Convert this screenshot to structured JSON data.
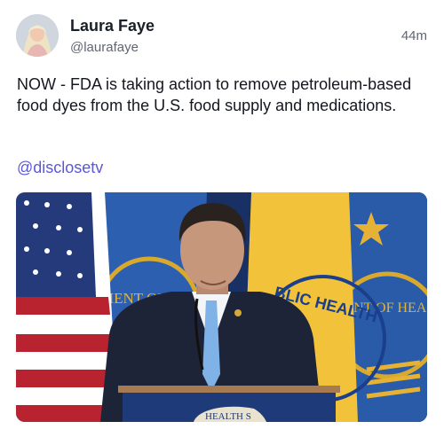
{
  "post": {
    "author": {
      "name": "Laura Faye",
      "handle": "@laurafaye"
    },
    "timestamp": "44m",
    "text": "NOW - FDA is taking action to remove petroleum-based food dyes from the U.S. food supply and medications.",
    "mention": "@disclosetv",
    "media": {
      "seal_left_text": "MENT OF",
      "seal_right_text": "NT OF HEA",
      "flag_text": "BLIC HEALTH",
      "podium_text": "HEALTH S"
    }
  },
  "colors": {
    "mention": "#5b57d6",
    "flag_blue": "#2a5ba8",
    "flag_gold": "#f2c33a",
    "podium": "#1f3a78"
  }
}
